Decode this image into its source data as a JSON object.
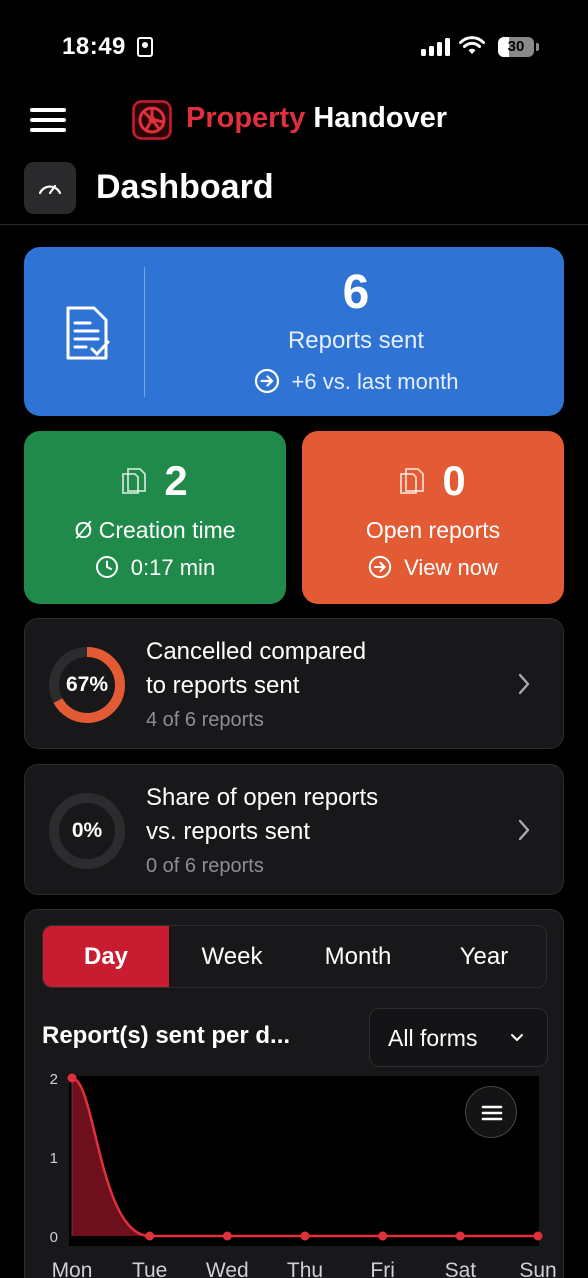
{
  "status_bar": {
    "time": "18:49",
    "battery": "30",
    "battery_level": 0.3
  },
  "header": {
    "brand_red": "Property",
    "brand_white": "Handover",
    "page_title": "Dashboard"
  },
  "reports_sent": {
    "value": "6",
    "label": "Reports sent",
    "trend": "+6 vs. last month"
  },
  "creation_time": {
    "value": "2",
    "label": "Ø Creation time",
    "time": "0:17 min"
  },
  "open_reports": {
    "value": "0",
    "label": "Open reports",
    "action": "View now"
  },
  "cancelled": {
    "percent_label": "67%",
    "percent": 0.67,
    "title_line1": "Cancelled compared",
    "title_line2": "to reports sent",
    "sub": "4 of 6 reports"
  },
  "open_share": {
    "percent_label": "0%",
    "percent": 0,
    "title_line1": "Share of open reports",
    "title_line2": "vs. reports sent",
    "sub": "0 of 6 reports"
  },
  "tabs": [
    "Day",
    "Week",
    "Month",
    "Year"
  ],
  "active_tab": "Day",
  "chart_panel": {
    "title": "Report(s) sent per d...",
    "filter": "All forms"
  },
  "colors": {
    "brand_red": "#e0303c",
    "blue_card": "#2f74d5",
    "green_card": "#1f8a4a",
    "orange_card": "#e35b35",
    "ring_cancelled": "#e35b35",
    "line": "#e0303c"
  },
  "chart_data": {
    "type": "area",
    "categories": [
      "Mon",
      "Tue",
      "Wed",
      "Thu",
      "Fri",
      "Sat",
      "Sun"
    ],
    "values": [
      2,
      0,
      0,
      0,
      0,
      0,
      0
    ],
    "yticks": [
      "0",
      "1",
      "2"
    ],
    "ylim": [
      0,
      2
    ],
    "title": "Report(s) sent per d...",
    "xlabel": "",
    "ylabel": ""
  }
}
